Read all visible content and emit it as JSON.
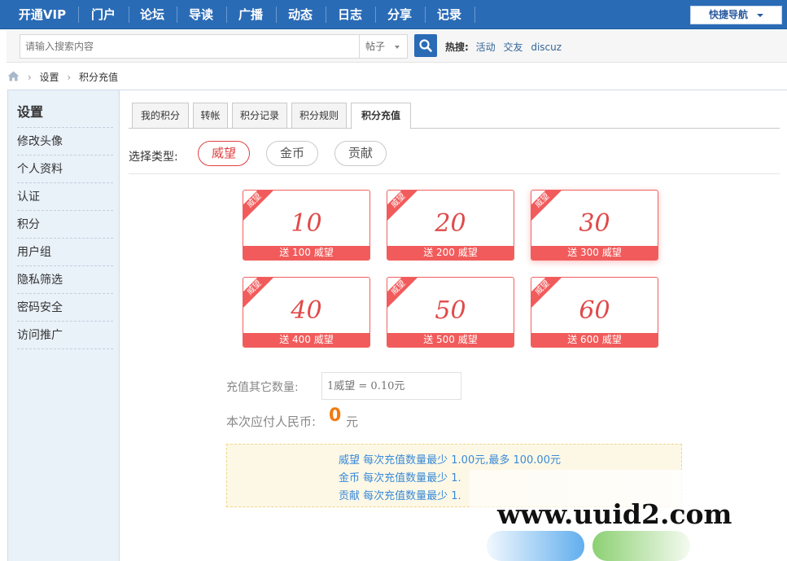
{
  "topnav": {
    "items": [
      "开通VIP",
      "门户",
      "论坛",
      "导读",
      "广播",
      "动态",
      "日志",
      "分享",
      "记录"
    ],
    "quick_nav_label": "快捷导航"
  },
  "search": {
    "placeholder": "请输入搜索内容",
    "type_selected": "帖子",
    "hot_label": "热搜:",
    "hot_links": [
      "活动",
      "交友",
      "discuz"
    ]
  },
  "breadcrumb": {
    "items": [
      "设置",
      "积分充值"
    ]
  },
  "sidebar": {
    "title": "设置",
    "items": [
      "修改头像",
      "个人资料",
      "认证",
      "积分",
      "用户组",
      "隐私筛选",
      "密码安全",
      "访问推广"
    ]
  },
  "tabs": {
    "items": [
      "我的积分",
      "转帐",
      "积分记录",
      "积分规则",
      "积分充值"
    ],
    "active_index": 4
  },
  "type_select": {
    "label": "选择类型:",
    "options": [
      "威望",
      "金币",
      "贡献"
    ],
    "selected_index": 0
  },
  "packages": [
    {
      "ribbon": "威望",
      "amount": "10",
      "bonus": "送 100 威望"
    },
    {
      "ribbon": "威望",
      "amount": "20",
      "bonus": "送 200 威望"
    },
    {
      "ribbon": "威望",
      "amount": "30",
      "bonus": "送 300 威望"
    },
    {
      "ribbon": "威望",
      "amount": "40",
      "bonus": "送 400 威望"
    },
    {
      "ribbon": "威望",
      "amount": "50",
      "bonus": "送 500 威望"
    },
    {
      "ribbon": "威望",
      "amount": "60",
      "bonus": "送 600 威望"
    }
  ],
  "other": {
    "label": "充值其它数量:",
    "placeholder": "1威望 = 0.10元"
  },
  "payment": {
    "label": "本次应付人民币:",
    "amount": "0",
    "unit": "元"
  },
  "notice": {
    "lines": [
      "威望 每次充值数量最少 1.00元,最多 100.00元",
      "金币 每次充值数量最少 1.",
      "贡献 每次充值数量最少 1."
    ]
  },
  "watermark": {
    "text": "www.uuid2.com"
  },
  "colors": {
    "nav_blue": "#2a6bb6",
    "accent_red": "#f25b5b",
    "pay_orange": "#f07b10",
    "notice_blue": "#3a8ad8"
  }
}
